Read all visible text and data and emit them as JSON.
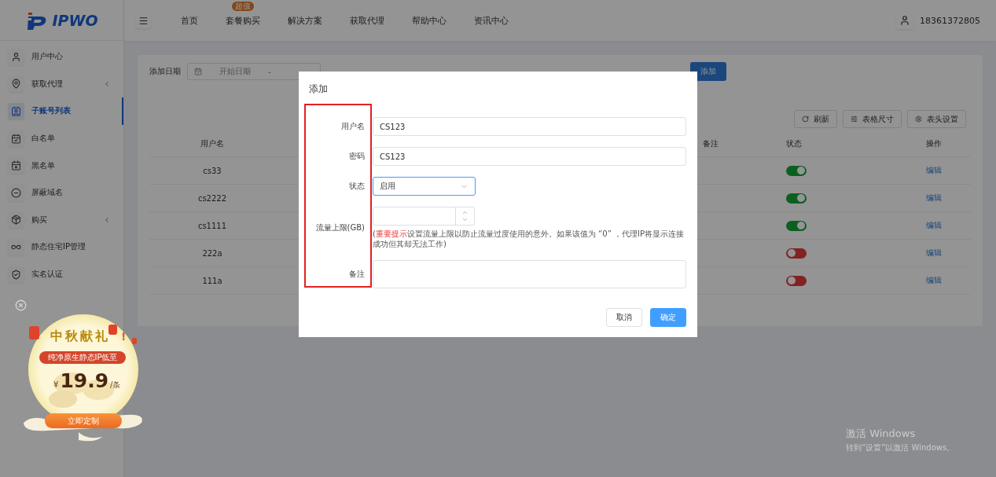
{
  "logo": {
    "text": "IPWO"
  },
  "topnav": {
    "items": [
      {
        "label": "首页"
      },
      {
        "label": "套餐购买",
        "badge": "超值"
      },
      {
        "label": "解决方案"
      },
      {
        "label": "获取代理"
      },
      {
        "label": "帮助中心"
      },
      {
        "label": "资讯中心"
      }
    ],
    "user": "18361372805"
  },
  "sidebar": {
    "items": [
      {
        "label": "用户中心",
        "selected": false,
        "has_submenu": false
      },
      {
        "label": "获取代理",
        "selected": false,
        "has_submenu": true
      },
      {
        "label": "子账号列表",
        "selected": true,
        "has_submenu": false
      },
      {
        "label": "白名单",
        "selected": false,
        "has_submenu": false
      },
      {
        "label": "黑名单",
        "selected": false,
        "has_submenu": false
      },
      {
        "label": "屏蔽域名",
        "selected": false,
        "has_submenu": false
      },
      {
        "label": "购买",
        "selected": false,
        "has_submenu": true
      },
      {
        "label": "静态住宅IP管理",
        "selected": false,
        "has_submenu": false
      },
      {
        "label": "实名认证",
        "selected": false,
        "has_submenu": false
      }
    ]
  },
  "filters": {
    "date_label": "添加日期",
    "start_placeholder": "开始日期",
    "separator": "-",
    "add_button": "添加"
  },
  "toolbar": [
    "刷新",
    "表格尺寸",
    "表头设置"
  ],
  "table": {
    "columns": [
      "用户名",
      "备注",
      "状态",
      "操作"
    ],
    "rows": [
      {
        "username": "cs33",
        "enabled": true,
        "action": "编辑"
      },
      {
        "username": "cs2222",
        "enabled": true,
        "action": "编辑"
      },
      {
        "username": "cs1111",
        "enabled": true,
        "action": "编辑"
      },
      {
        "username": "222a",
        "enabled": false,
        "action": "编辑"
      },
      {
        "username": "111a",
        "enabled": false,
        "action": "编辑"
      }
    ]
  },
  "dialog": {
    "title": "添加",
    "fields": [
      {
        "kind": "text",
        "label": "用户名",
        "value": "CS123"
      },
      {
        "kind": "text",
        "label": "密码",
        "value": "CS123"
      },
      {
        "kind": "select",
        "label": "状态",
        "value": "启用"
      },
      {
        "kind": "number",
        "label": "流量上限(GB)",
        "hint": "(**重要提示**设置流量上限以防止流量过度使用的意外。如果该值为 “0” ，代理IP将显示连接成功但其却无法工作)"
      },
      {
        "kind": "textarea",
        "label": "备注"
      }
    ],
    "buttons": [
      {
        "label": "取消",
        "kind": "secondary"
      },
      {
        "label": "确定",
        "kind": "primary"
      }
    ]
  },
  "promo": {
    "title": "中秋献礼",
    "exclaim": "!",
    "tagline": "纯净原生静态IP低至",
    "currency": "¥",
    "price": "19.9",
    "unit": "/条",
    "button": "立即定制"
  },
  "os_notice": {
    "title": "激活 Windows",
    "subtitle": "转到“设置”以激活 Windows。"
  }
}
